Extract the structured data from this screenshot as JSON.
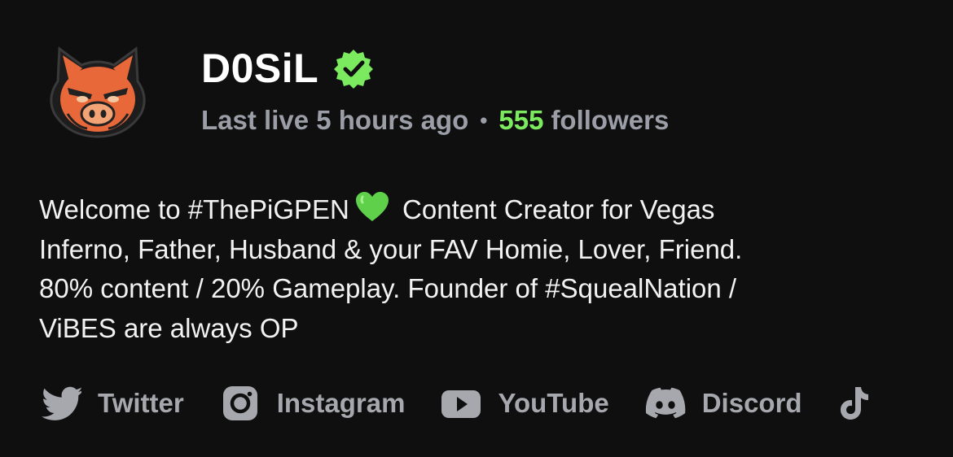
{
  "channel": {
    "name": "D0SiL",
    "verified": true,
    "last_live": "Last live 5 hours ago",
    "separator": "•",
    "followers_count": "555",
    "followers_label": "followers"
  },
  "bio": {
    "part1": "Welcome to #ThePiGPEN",
    "emoji": "green-heart",
    "part2": "Content Creator for Vegas\nInferno, Father, Husband & your FAV Homie, Lover, Friend.\n80% content / 20% Gameplay. Founder of #SquealNation /\nViBES are always OP"
  },
  "socials": [
    {
      "label": "Twitter",
      "icon": "twitter-icon"
    },
    {
      "label": "Instagram",
      "icon": "instagram-icon"
    },
    {
      "label": "YouTube",
      "icon": "youtube-icon"
    },
    {
      "label": "Discord",
      "icon": "discord-icon"
    },
    {
      "label": "",
      "icon": "tiktok-icon"
    }
  ],
  "colors": {
    "background": "#0f0f10",
    "accent_green": "#7cea5e",
    "muted_text": "#9b9ea6",
    "avatar_orange": "#e8683a"
  }
}
